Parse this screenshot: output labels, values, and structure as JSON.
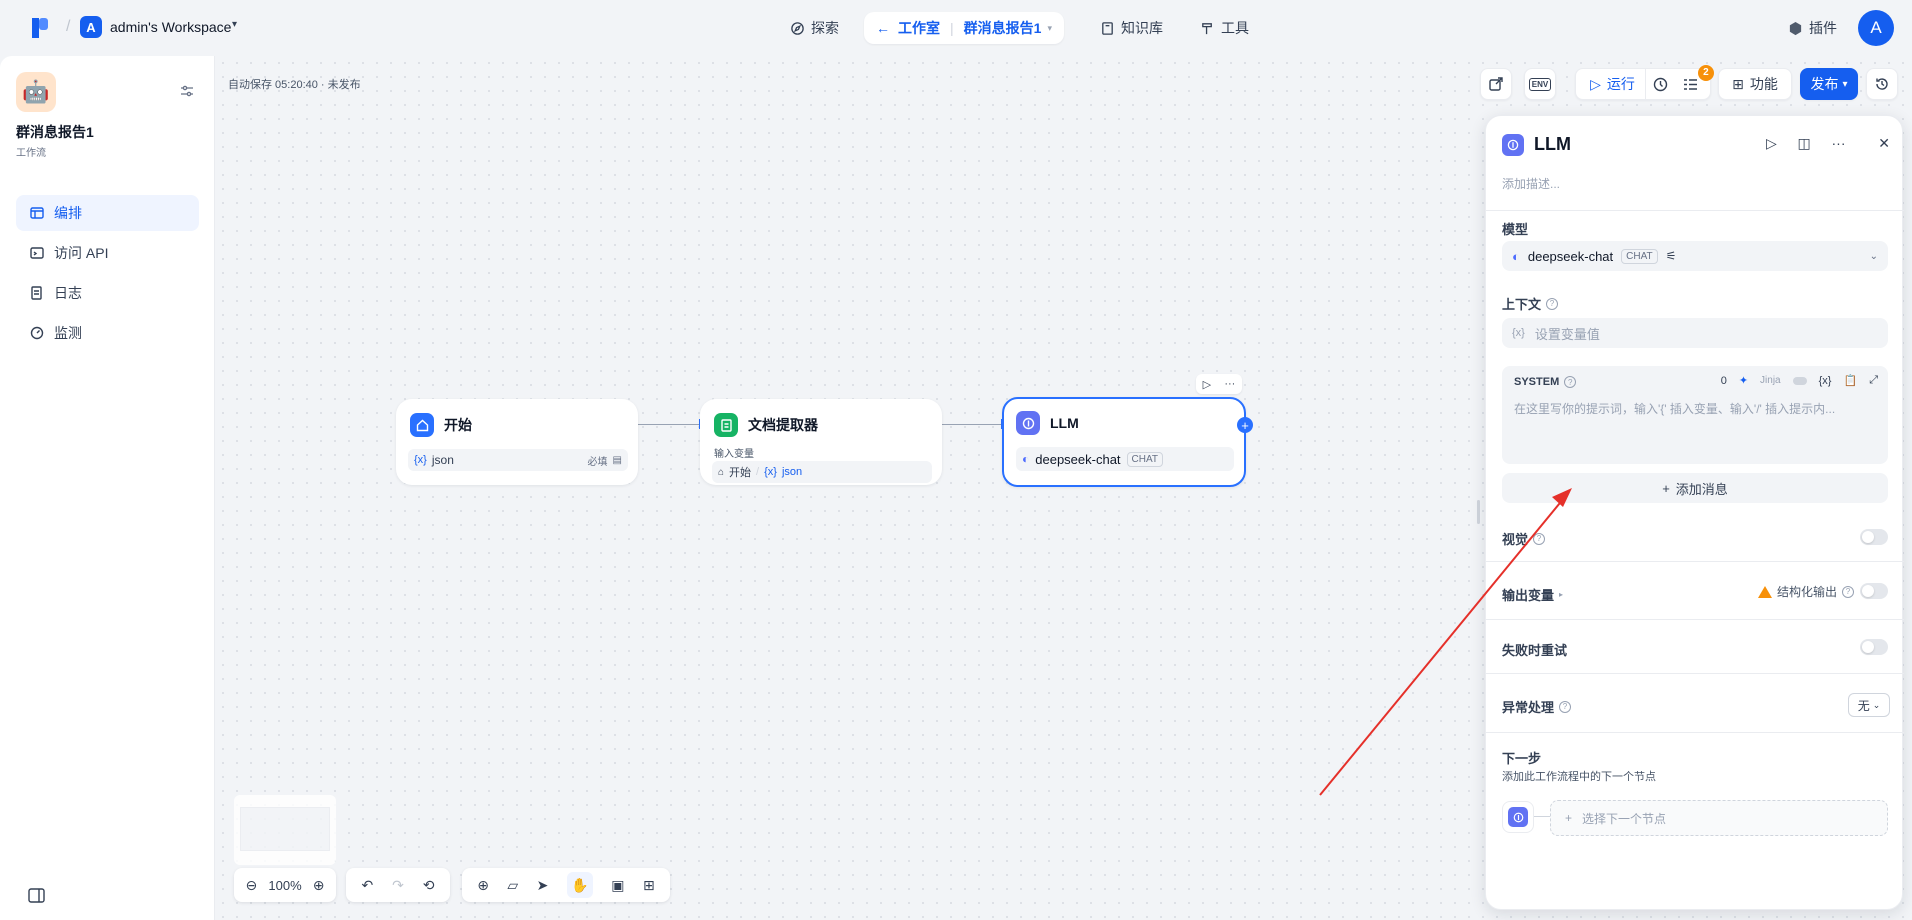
{
  "header": {
    "workspace_initial": "A",
    "workspace_name": "admin's Workspace",
    "nav_explore": "探索",
    "nav_studio": "工作室",
    "nav_app": "群消息报告1",
    "nav_knowledge": "知识库",
    "nav_tools": "工具",
    "nav_plugins": "插件",
    "user_initial": "A"
  },
  "sidebar": {
    "app_title": "群消息报告1",
    "app_type": "工作流",
    "items": [
      {
        "label": "编排",
        "icon": "layout-icon",
        "active": true
      },
      {
        "label": "访问 API",
        "icon": "terminal-icon",
        "active": false
      },
      {
        "label": "日志",
        "icon": "log-icon",
        "active": false
      },
      {
        "label": "监测",
        "icon": "gauge-icon",
        "active": false
      }
    ]
  },
  "canvas": {
    "autosave": "自动保存 05:20:40 · 未发布",
    "toolbar": {
      "env": "ENV",
      "run": "运行",
      "badge_count": "2",
      "features": "功能",
      "publish": "发布"
    },
    "nodes": {
      "start": {
        "title": "开始",
        "var_brace": "{x}",
        "var_name": "json",
        "required": "必填"
      },
      "doc": {
        "title": "文档提取器",
        "sub": "输入变量",
        "src": "开始",
        "var_brace": "{x}",
        "var_name": "json"
      },
      "llm": {
        "title": "LLM",
        "model": "deepseek-chat",
        "tag": "CHAT"
      }
    },
    "zoom": "100%"
  },
  "panel": {
    "title": "LLM",
    "desc_placeholder": "添加描述...",
    "model_label": "模型",
    "model_name": "deepseek-chat",
    "model_tag": "CHAT",
    "context_label": "上下文",
    "context_brace": "{x}",
    "context_placeholder": "设置变量值",
    "system_label": "SYSTEM",
    "system_count": "0",
    "jinja_label": "Jinja",
    "system_var": "{x}",
    "system_placeholder": "在这里写你的提示词，输入'{' 插入变量、输入'/' 插入提示内...",
    "add_message": "添加消息",
    "vision_label": "视觉",
    "output_label": "输出变量",
    "structured_label": "结构化输出",
    "retry_label": "失败时重试",
    "error_label": "异常处理",
    "error_value": "无",
    "next_title": "下一步",
    "next_desc": "添加此工作流程中的下一个节点",
    "next_placeholder": "选择下一个节点"
  },
  "colors": {
    "accent": "#155eef",
    "annotation_arrow": "#e5302a"
  }
}
